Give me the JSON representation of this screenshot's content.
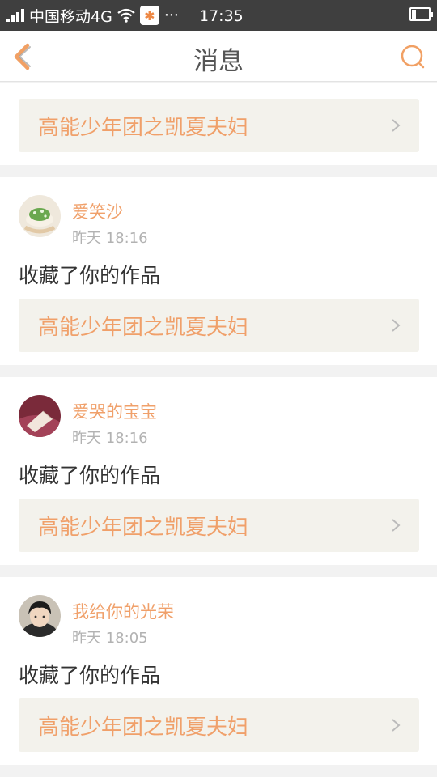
{
  "status_bar": {
    "carrier": "中国移动4G",
    "more": "···",
    "time": "17:35"
  },
  "nav": {
    "title": "消息"
  },
  "colors": {
    "accent": "#f0a06a",
    "work_bg": "#f3f2ec"
  },
  "messages": [
    {
      "work_title": "高能少年团之凯夏夫妇"
    },
    {
      "user": "爱笑沙",
      "time": "昨天 18:16",
      "action": "收藏了你的作品",
      "work_title": "高能少年团之凯夏夫妇"
    },
    {
      "user": "爱哭的宝宝",
      "time": "昨天 18:16",
      "action": "收藏了你的作品",
      "work_title": "高能少年团之凯夏夫妇"
    },
    {
      "user": "我给你的光荣",
      "time": "昨天 18:05",
      "action": "收藏了你的作品",
      "work_title": "高能少年团之凯夏夫妇"
    }
  ]
}
